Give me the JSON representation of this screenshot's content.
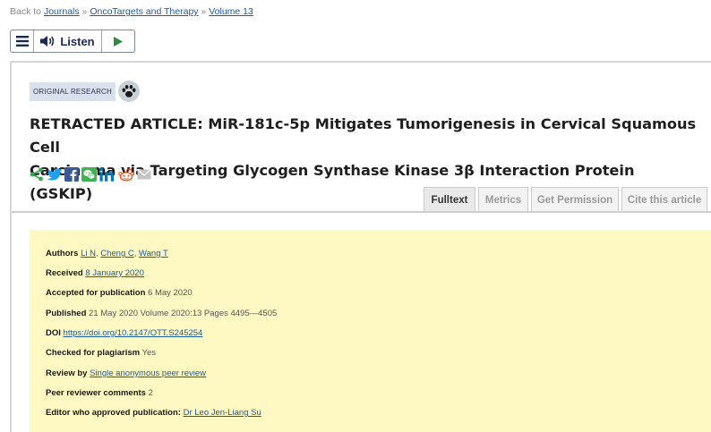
{
  "breadcrumb": {
    "prefix": "Back to ",
    "items": [
      "Journals",
      "OncoTargets and Therapy",
      "Volume 13"
    ],
    "separator": " » "
  },
  "listen_bar": {
    "menu_icon": "hamburger-icon",
    "speaker_icon": "speaker-icon",
    "listen_label": "Listen",
    "play_icon": "play-icon"
  },
  "article": {
    "badge": "ORIGINAL RESEARCH",
    "open_access_icon": "paw-icon",
    "title_line1": "RETRACTED ARTICLE: MiR-181c-5p Mitigates Tumorigenesis in Cervical Squamous Cell",
    "title_line2": "Carcinoma via Targeting Glycogen Synthase Kinase 3β Interaction Protein (GSKIP)"
  },
  "share_icons": [
    "share-icon",
    "twitter-icon",
    "facebook-icon",
    "wechat-icon",
    "linkedin-icon",
    "reddit-icon",
    "email-icon"
  ],
  "tabs": [
    {
      "label": "Fulltext",
      "active": true
    },
    {
      "label": "Metrics",
      "active": false
    },
    {
      "label": "Get Permission",
      "active": false
    },
    {
      "label": "Cite this article",
      "active": false
    }
  ],
  "meta": {
    "authors": {
      "key": "Authors",
      "names": [
        "Li N",
        "Cheng C",
        "Wang T"
      ]
    },
    "received": {
      "key": "Received",
      "value": "8 January 2020"
    },
    "accepted": {
      "key": "Accepted for publication",
      "value": "6 May 2020"
    },
    "published": {
      "key": "Published",
      "value": "21 May 2020 Volume 2020:13 Pages 4495—4505"
    },
    "doi": {
      "key": "DOI",
      "value": "https://doi.org/10.2147/OTT.S245254"
    },
    "plagiarism": {
      "key": "Checked for plagiarism",
      "value": "Yes"
    },
    "review": {
      "key": "Review by",
      "value": "Single anonymous peer review"
    },
    "peer_comments": {
      "key": "Peer reviewer comments",
      "value": "2"
    },
    "editor": {
      "key": "Editor who approved publication:",
      "value": "Dr Leo Jen-Liang Su"
    }
  },
  "colors": {
    "link": "#1d5a9e",
    "meta_background": "#fef9c2",
    "badge_background": "#d9e1ef",
    "share_green": "#3aa757",
    "twitter_blue": "#1da1f2",
    "facebook_blue": "#3b5998",
    "wechat_green": "#3fb34f",
    "linkedin_blue": "#0077b5"
  }
}
